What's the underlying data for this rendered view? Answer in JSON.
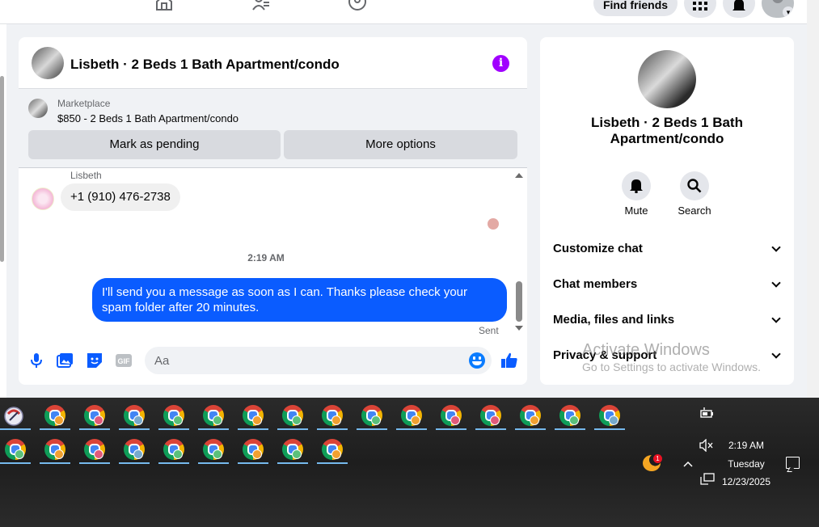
{
  "topnav": {
    "find_friends_label": "Find friends"
  },
  "chat": {
    "title": "Lisbeth · 2 Beds 1 Bath Apartment/condo",
    "marketplace": {
      "label": "Marketplace",
      "listing": "$850 - 2 Beds 1 Bath Apartment/condo",
      "pending_button": "Mark as pending",
      "more_button": "More options"
    },
    "messages": {
      "sender_name": "Lisbeth",
      "incoming_text": "+1 (910) 476-2738",
      "timestamp": "2:19 AM",
      "outgoing_text": "I'll send you a message as soon as I can. Thanks please check your spam folder after 20 minutes.",
      "status": "Sent"
    },
    "composer": {
      "placeholder": "Aa",
      "value": ""
    }
  },
  "info_panel": {
    "title": "Lisbeth · 2 Beds 1 Bath Apartment/condo",
    "actions": [
      {
        "label": "Mute",
        "icon": "bell-icon"
      },
      {
        "label": "Search",
        "icon": "search-icon"
      }
    ],
    "sections": [
      {
        "label": "Customize chat"
      },
      {
        "label": "Chat members"
      },
      {
        "label": "Media, files and links"
      },
      {
        "label": "Privacy & support"
      }
    ]
  },
  "watermark": {
    "line1": "Activate Windows",
    "line2": "Go to Settings to activate Windows."
  },
  "taskbar": {
    "time": "2:19 AM",
    "day": "Tuesday",
    "date": "12/23/2025",
    "weather_badge": "1"
  },
  "colors": {
    "accent": "#0a5cff",
    "info_icon": "#a100ff",
    "taskbar_underline": "#76b9ed"
  }
}
